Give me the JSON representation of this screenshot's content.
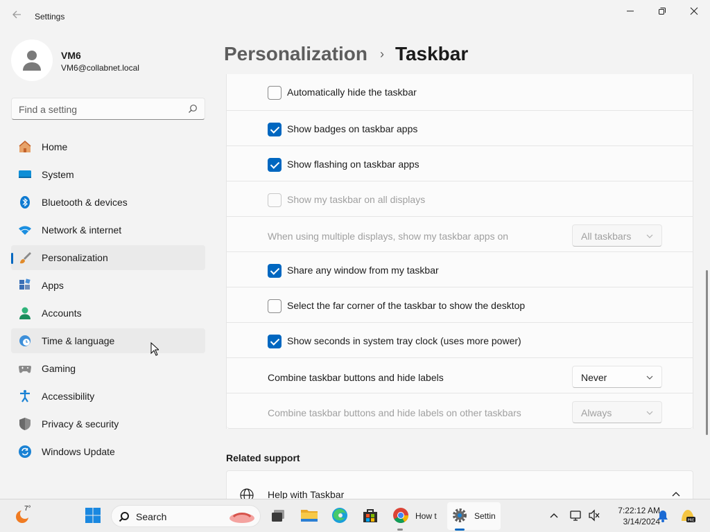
{
  "window": {
    "title": "Settings"
  },
  "profile": {
    "name": "VM6",
    "email": "VM6@collabnet.local"
  },
  "search": {
    "placeholder": "Find a setting"
  },
  "sidebar": {
    "items": [
      {
        "label": "Home",
        "icon": "home-icon"
      },
      {
        "label": "System",
        "icon": "system-icon"
      },
      {
        "label": "Bluetooth & devices",
        "icon": "bluetooth-icon"
      },
      {
        "label": "Network & internet",
        "icon": "wifi-icon"
      },
      {
        "label": "Personalization",
        "icon": "brush-icon",
        "selected": true
      },
      {
        "label": "Apps",
        "icon": "apps-icon"
      },
      {
        "label": "Accounts",
        "icon": "accounts-icon"
      },
      {
        "label": "Time & language",
        "icon": "clock-globe-icon",
        "hover": true
      },
      {
        "label": "Gaming",
        "icon": "gamepad-icon"
      },
      {
        "label": "Accessibility",
        "icon": "accessibility-icon"
      },
      {
        "label": "Privacy & security",
        "icon": "shield-icon"
      },
      {
        "label": "Windows Update",
        "icon": "update-icon"
      }
    ]
  },
  "breadcrumb": {
    "parent": "Personalization",
    "separator": "›",
    "current": "Taskbar"
  },
  "settings": {
    "rows": [
      {
        "type": "checkbox",
        "label": "Automatically hide the taskbar",
        "checked": false,
        "disabled": false
      },
      {
        "type": "checkbox",
        "label": "Show badges on taskbar apps",
        "checked": true,
        "disabled": false
      },
      {
        "type": "checkbox",
        "label": "Show flashing on taskbar apps",
        "checked": true,
        "disabled": false
      },
      {
        "type": "checkbox",
        "label": "Show my taskbar on all displays",
        "checked": false,
        "disabled": true
      },
      {
        "type": "dropdown",
        "label": "When using multiple displays, show my taskbar apps on",
        "value": "All taskbars",
        "disabled": true
      },
      {
        "type": "checkbox",
        "label": "Share any window from my taskbar",
        "checked": true,
        "disabled": false
      },
      {
        "type": "checkbox",
        "label": "Select the far corner of the taskbar to show the desktop",
        "checked": false,
        "disabled": false
      },
      {
        "type": "checkbox",
        "label": "Show seconds in system tray clock (uses more power)",
        "checked": true,
        "disabled": false
      },
      {
        "type": "dropdown",
        "label": "Combine taskbar buttons and hide labels",
        "value": "Never",
        "disabled": false
      },
      {
        "type": "dropdown",
        "label": "Combine taskbar buttons and hide labels on other taskbars",
        "value": "Always",
        "disabled": true
      }
    ]
  },
  "related": {
    "title": "Related support",
    "help_label": "Help with Taskbar"
  },
  "taskbar": {
    "temperature": "7°",
    "search_label": "Search",
    "chrome_label": "How t",
    "settings_label": "Settin",
    "time": "7:22:12 AM",
    "date": "3/14/2024"
  },
  "colors": {
    "accent": "#0067c0"
  }
}
